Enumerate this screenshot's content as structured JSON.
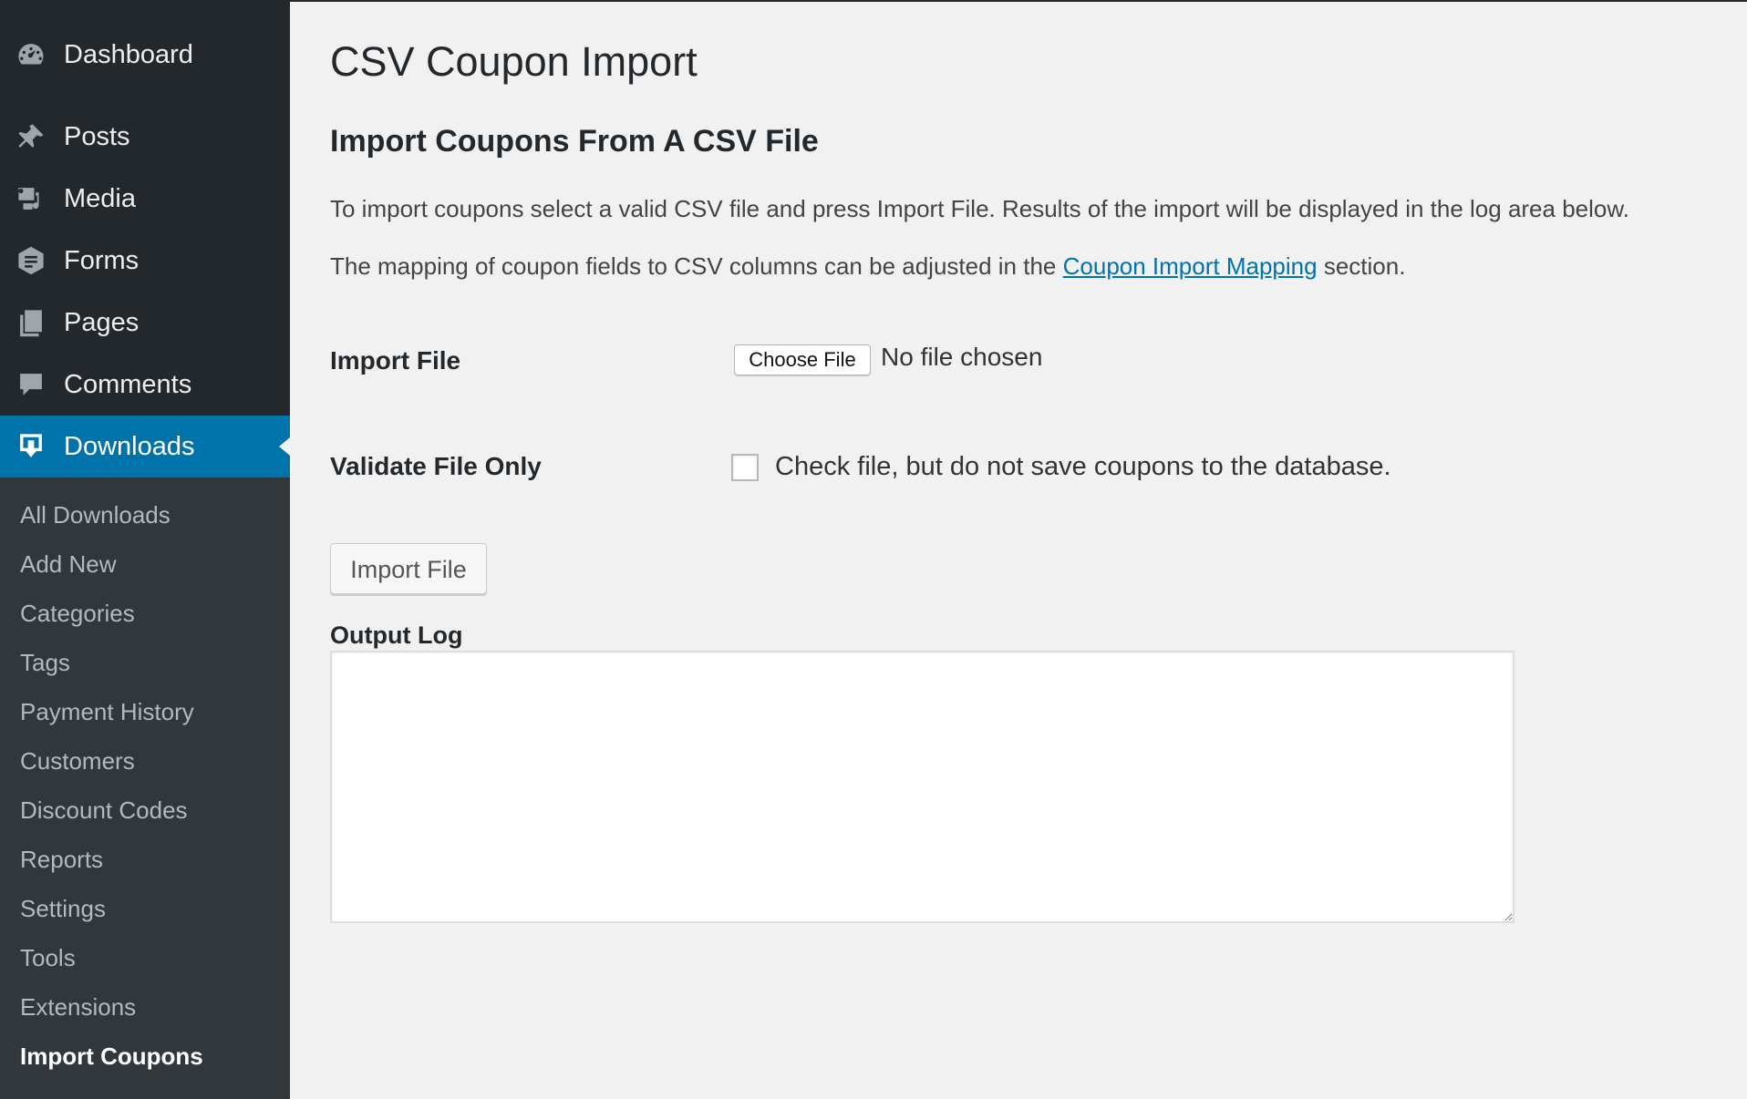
{
  "sidebar": {
    "menu": [
      {
        "label": "Dashboard",
        "icon": "dashboard-icon"
      },
      {
        "label": "Posts",
        "icon": "pin-icon"
      },
      {
        "label": "Media",
        "icon": "media-icon"
      },
      {
        "label": "Forms",
        "icon": "forms-icon"
      },
      {
        "label": "Pages",
        "icon": "pages-icon"
      },
      {
        "label": "Comments",
        "icon": "comment-icon"
      },
      {
        "label": "Downloads",
        "icon": "download-icon",
        "current": true
      }
    ],
    "submenu": [
      "All Downloads",
      "Add New",
      "Categories",
      "Tags",
      "Payment History",
      "Customers",
      "Discount Codes",
      "Reports",
      "Settings",
      "Tools",
      "Extensions",
      "Import Coupons"
    ],
    "active_submenu": "Import Coupons"
  },
  "page": {
    "title": "CSV Coupon Import",
    "section_title": "Import Coupons From A CSV File",
    "intro": "To import coupons select a valid CSV file and press Import File. Results of the import will be displayed in the log area below.",
    "mapping_prefix": "The mapping of coupon fields to CSV columns can be adjusted in the",
    "mapping_link": "Coupon Import Mapping",
    "mapping_suffix": "section."
  },
  "form": {
    "import_file_label": "Import File",
    "choose_file_button": "Choose File",
    "file_status": "No file chosen",
    "validate_label": "Validate File Only",
    "validate_checkbox_text": "Check file, but do not save coupons to the database.",
    "validate_checked": false,
    "import_button": "Import File",
    "output_log_label": "Output Log",
    "output_log_value": ""
  },
  "colors": {
    "sidebar_bg": "#23282d",
    "submenu_bg": "#32373c",
    "accent": "#0073aa",
    "content_bg": "#f1f1f1"
  }
}
